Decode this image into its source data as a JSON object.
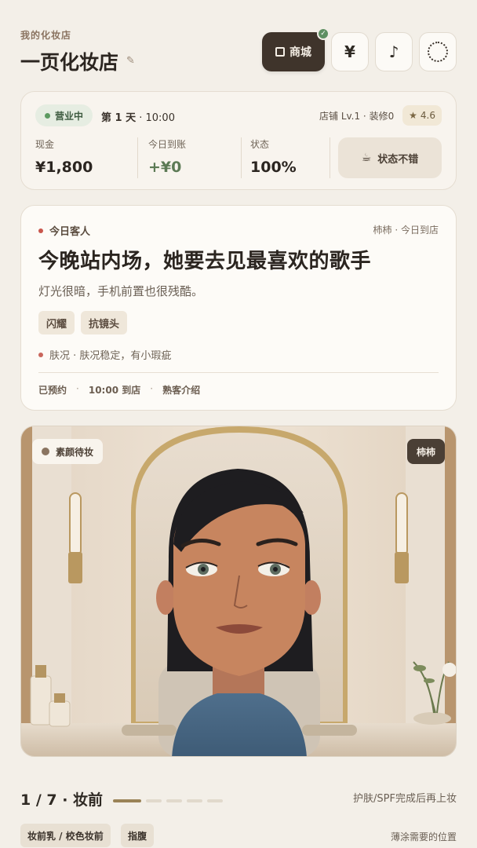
{
  "header": {
    "subtitle": "我的化妆店",
    "title": "一页化妆店",
    "shop_label": "商城",
    "currency_label": "¥",
    "music_label": "♪"
  },
  "status": {
    "open_label": "营业中",
    "day_prefix": "第 1 天",
    "time": "· 10:00",
    "store_level": "店铺 Lv.1 · 装修0",
    "rating": "4.6",
    "cash_label": "现金",
    "cash_value": "¥1,800",
    "income_label": "今日到账",
    "income_value": "+¥0",
    "state_label": "状态",
    "state_value": "100%",
    "mood_label": "状态不错"
  },
  "customer": {
    "section_label": "今日客人",
    "meta": "柿柿 · 今日到店",
    "headline": "今晚站内场，她要去见最喜欢的歌手",
    "description": "灯光很暗，手机前置也很残酷。",
    "tags": [
      "闪耀",
      "抗镜头"
    ],
    "skin_note": "肤况 · 肤况稳定，有小瑕疵",
    "footer": {
      "booked": "已预约",
      "arrival": "10:00 到店",
      "source": "熟客介绍"
    }
  },
  "scene": {
    "status_pill": "素颜待妆",
    "customer_name": "柿柿"
  },
  "step": {
    "label": "1 / 7 · 妆前",
    "hint": "护肤/SPF完成后再上妆",
    "current": 1,
    "total": 5
  },
  "products": {
    "items": [
      "妆前乳 / 校色妆前",
      "指腹"
    ],
    "hint": "薄涂需要的位置"
  },
  "colors": {
    "accent": "#3f342b",
    "open_green": "#5c9a60",
    "progress_active": "#9a8256"
  }
}
